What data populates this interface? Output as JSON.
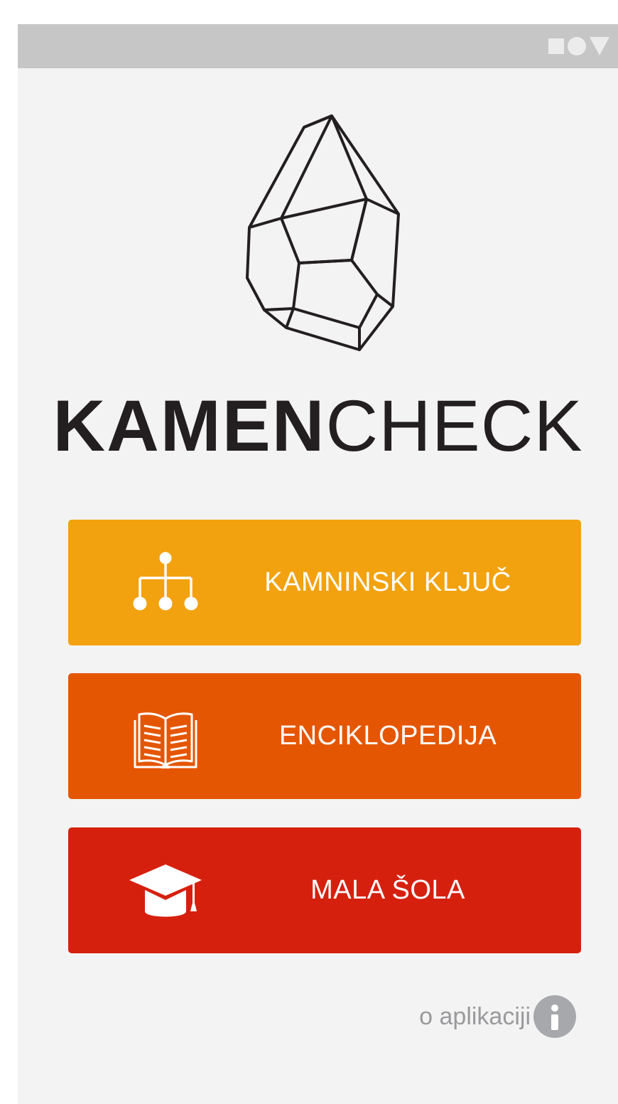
{
  "app": {
    "wordmark_bold": "KAMEN",
    "wordmark_light": "CHECK"
  },
  "status_bar": {
    "icons": [
      "square-icon",
      "circle-icon",
      "triangle-icon"
    ]
  },
  "menu": {
    "items": [
      {
        "label": "KAMNINSKI KLJUČ",
        "icon": "hierarchy-icon",
        "color": "#f2a20f"
      },
      {
        "label": "ENCIKLOPEDIJA",
        "icon": "open-book-icon",
        "color": "#e55602"
      },
      {
        "label": "MALA ŠOLA",
        "icon": "graduation-cap-icon",
        "color": "#d6200e"
      }
    ]
  },
  "footer": {
    "about_label": "o aplikaciji",
    "about_icon": "info-icon"
  },
  "colors": {
    "background": "#f3f3f3",
    "status_bar": "#c6c6c6",
    "text_dark": "#231f20",
    "muted": "#9a9a9d"
  }
}
